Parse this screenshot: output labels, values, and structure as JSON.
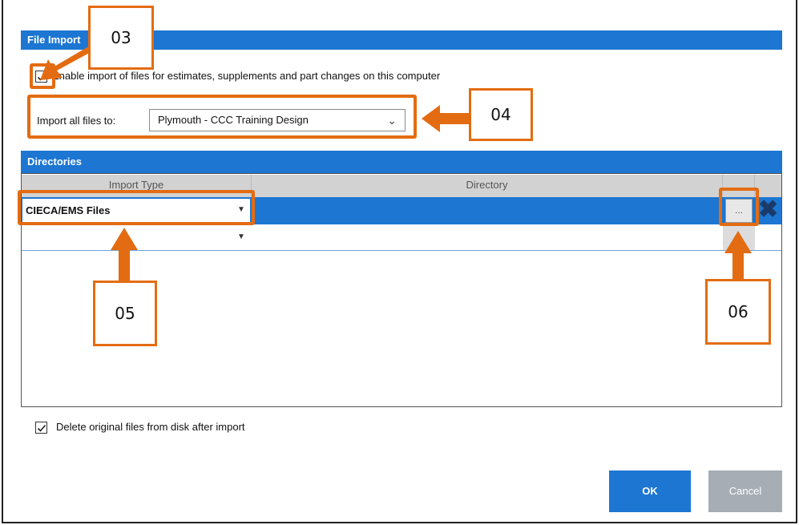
{
  "file_import": {
    "header": "File Import",
    "enable_checkbox": {
      "checked": true,
      "label": "Enable import of files for estimates, supplements and part changes on this computer"
    },
    "import_to": {
      "label": "Import all files to:",
      "value": "Plymouth - CCC Training Design"
    }
  },
  "directories": {
    "header": "Directories",
    "columns": [
      "Import Type",
      "Directory"
    ],
    "rows": [
      {
        "import_type": "CIECA/EMS Files",
        "directory": "",
        "selected": true
      },
      {
        "import_type": "",
        "directory": "",
        "selected": false
      }
    ],
    "browse_label": "...",
    "delete_icon": "close-x-icon"
  },
  "delete_original": {
    "checked": true,
    "label": "Delete original files from disk after import"
  },
  "buttons": {
    "ok": "OK",
    "cancel": "Cancel"
  },
  "annotations": [
    "03",
    "04",
    "05",
    "06"
  ],
  "colors": {
    "accent": "#1c76d2",
    "annotation": "#e36c12",
    "cancel": "#a6adb5"
  }
}
